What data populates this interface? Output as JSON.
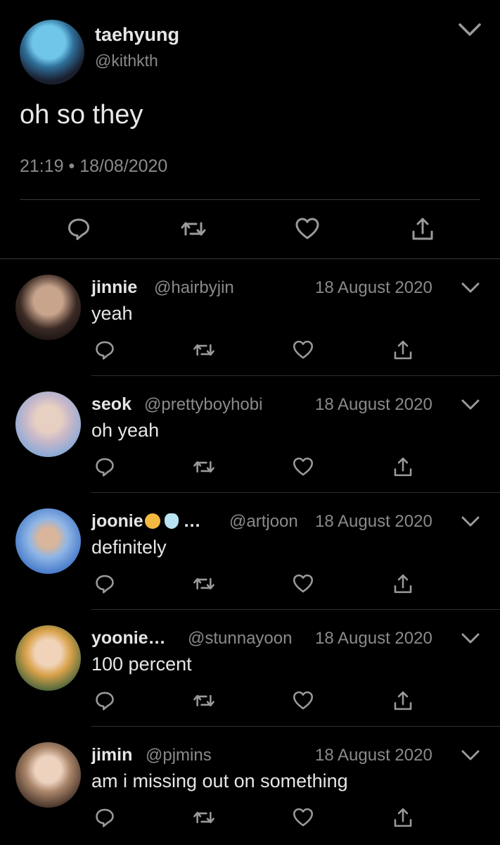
{
  "main": {
    "name": "taehyung",
    "handle": "@kithkth",
    "text": "oh so they",
    "timestamp": "21:19 • 18/08/2020"
  },
  "icons": {
    "reply": "reply-icon",
    "retweet": "retweet-icon",
    "like": "heart-icon",
    "share": "share-icon",
    "more": "chevron-down-icon"
  },
  "colors": {
    "background": "#000000",
    "primary_text": "#e6e6e6",
    "secondary_text": "#8a8a8a",
    "divider": "#3a3a3a"
  },
  "replies": [
    {
      "name": "jinnie",
      "handle": "@hairbyjin",
      "date": "18 August 2020",
      "text": "yeah"
    },
    {
      "name": "seok",
      "handle": "@prettyboyhobi",
      "date": "18 August 2020",
      "text": "oh yeah"
    },
    {
      "name": "joonie",
      "name_suffix": "…",
      "handle": "@artjoon",
      "date": "18 August 2020",
      "text": "definitely"
    },
    {
      "name": "yoonie…",
      "handle": "@stunnayoon",
      "date": "18 August 2020",
      "text": "100 percent"
    },
    {
      "name": "jimin",
      "handle": "@pjmins",
      "date": "18 August 2020",
      "text": "am i missing out on something"
    }
  ]
}
